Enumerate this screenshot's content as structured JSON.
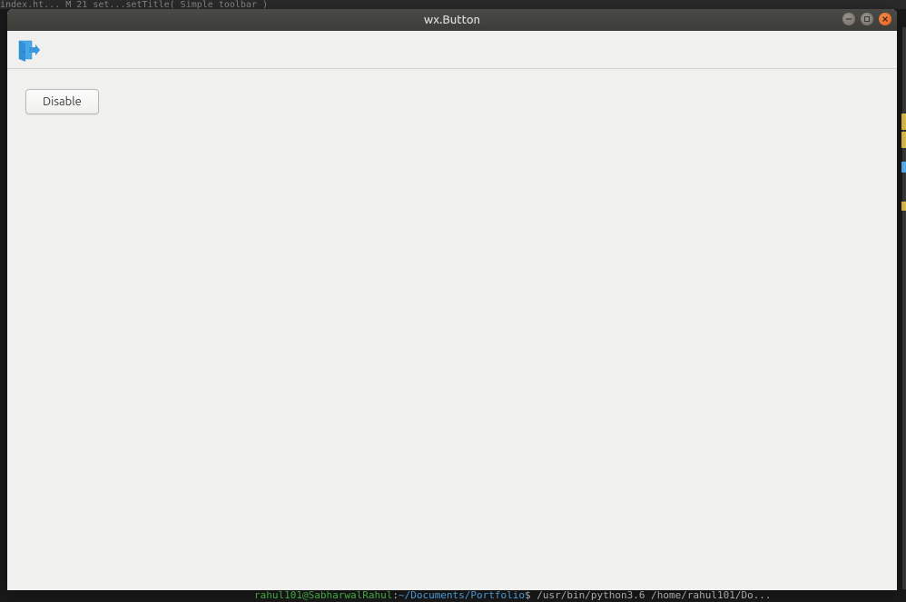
{
  "window": {
    "title": "wx.Button"
  },
  "toolbar": {
    "exit_icon": "exit-icon"
  },
  "content": {
    "button_label": "Disable"
  },
  "background": {
    "top_fragment": "  index.ht...     M        21           set...setTitle(  Simple toolbar  )",
    "bottom_user": "rahul101@SabharwalRahul",
    "bottom_path": "~/Documents/Portfolio",
    "bottom_cmd": "$ /usr/bin/python3.6 /home/rahul101/Do..."
  }
}
